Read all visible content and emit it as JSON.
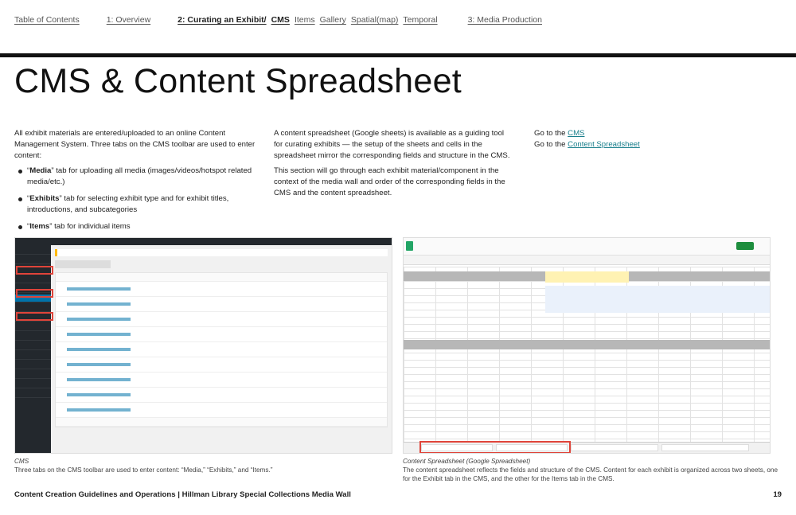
{
  "nav": {
    "toc": "Table of Contents",
    "overview": "1: Overview",
    "curating": "2: Curating an Exhibit/",
    "cms": "CMS",
    "items": "Items",
    "gallery": "Gallery",
    "spatial": "Spatial(map)",
    "temporal": "Temporal",
    "media": "3: Media Production"
  },
  "title": "CMS & Content Spreadsheet",
  "col1": {
    "intro": "All exhibit materials are entered/uploaded to an online Content Management System. Three tabs on the CMS toolbar are used to enter content:",
    "bullets": [
      {
        "open": "“",
        "bold": "Media",
        "rest": "” tab for uploading all media (images/videos/hotspot related media/etc.)"
      },
      {
        "open": "“",
        "bold": "Exhibits",
        "rest": "” tab for selecting exhibit type and for exhibit titles, introductions, and subcategories"
      },
      {
        "open": "“",
        "bold": "Items",
        "rest": "” tab for individual items"
      }
    ]
  },
  "col2": {
    "p1": "A content spreadsheet (Google sheets) is available as a guiding tool for curating exhibits — the setup of the sheets and cells in the spreadsheet mirror the corresponding fields and structure in the CMS.",
    "p2": "This section will go through each exhibit material/component in the context of the media wall and order of the corresponding fields in the CMS and the content spreadsheet."
  },
  "col3": {
    "goto": "Go to the",
    "link1": "CMS",
    "link2": "Content Spreadsheet"
  },
  "captions": {
    "left_title": "CMS",
    "left_text": "Three tabs on the CMS toolbar are used to enter content: “Media,” “Exhibits,” and “Items.”",
    "right_title": "Content Spreadsheet (Google Spreadsheet)",
    "right_text": "The content spreadsheet reflects the fields and structure of the CMS. Content for each exhibit is organized across two sheets, one for the Exhibit tab in the CMS, and the other for the Items tab in the CMS."
  },
  "footer": {
    "text": "Content Creation Guidelines and Operations | Hillman Library Special Collections Media Wall",
    "page": "19"
  }
}
